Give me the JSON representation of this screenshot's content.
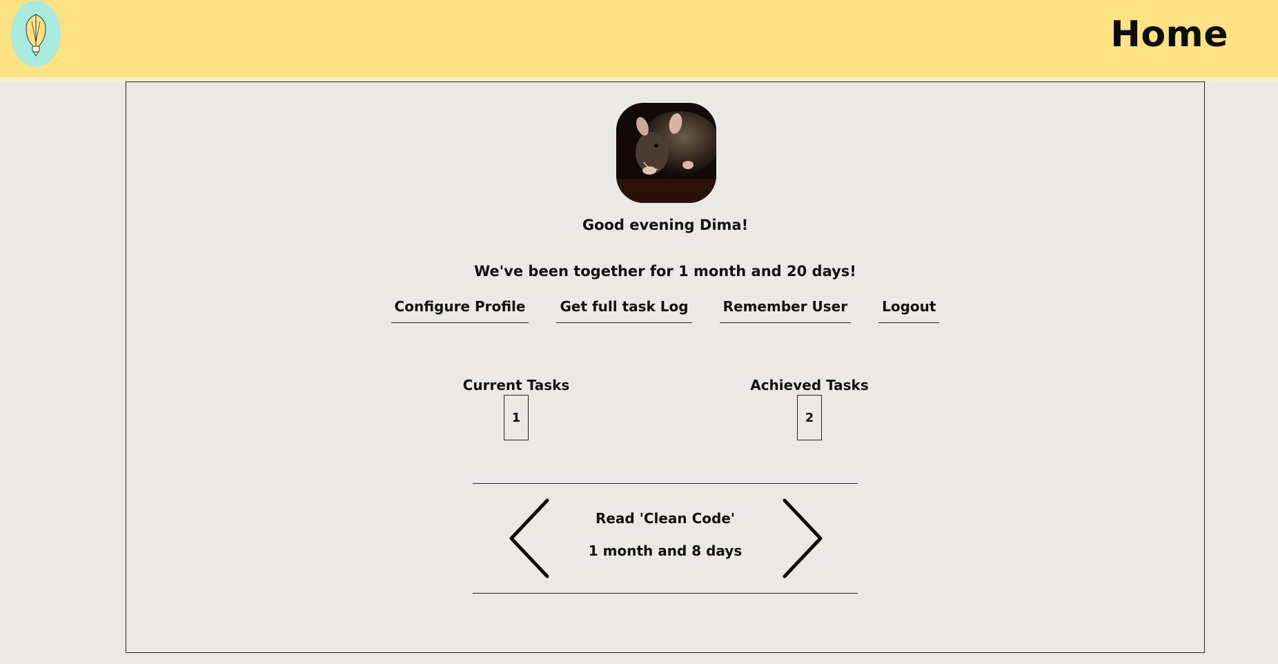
{
  "header": {
    "title": "Home",
    "logo_icon": "lightbulb-icon",
    "background_color": "#fce283"
  },
  "profile": {
    "avatar_icon": "rat-avatar-image",
    "greeting": "Good evening Dima!",
    "together_message": "We've been together for 1 month and 20 days!"
  },
  "nav": {
    "items": [
      {
        "label": "Configure Profile"
      },
      {
        "label": "Get full task Log"
      },
      {
        "label": "Remember User"
      },
      {
        "label": "Logout"
      }
    ]
  },
  "stats": {
    "current": {
      "label": "Current Tasks",
      "value": "1"
    },
    "achieved": {
      "label": "Achieved Tasks",
      "value": "2"
    }
  },
  "carousel": {
    "task_name": "Read 'Clean Code'",
    "task_duration": "1 month and 8 days",
    "prev_icon": "chevron-left-icon",
    "next_icon": "chevron-right-icon"
  }
}
